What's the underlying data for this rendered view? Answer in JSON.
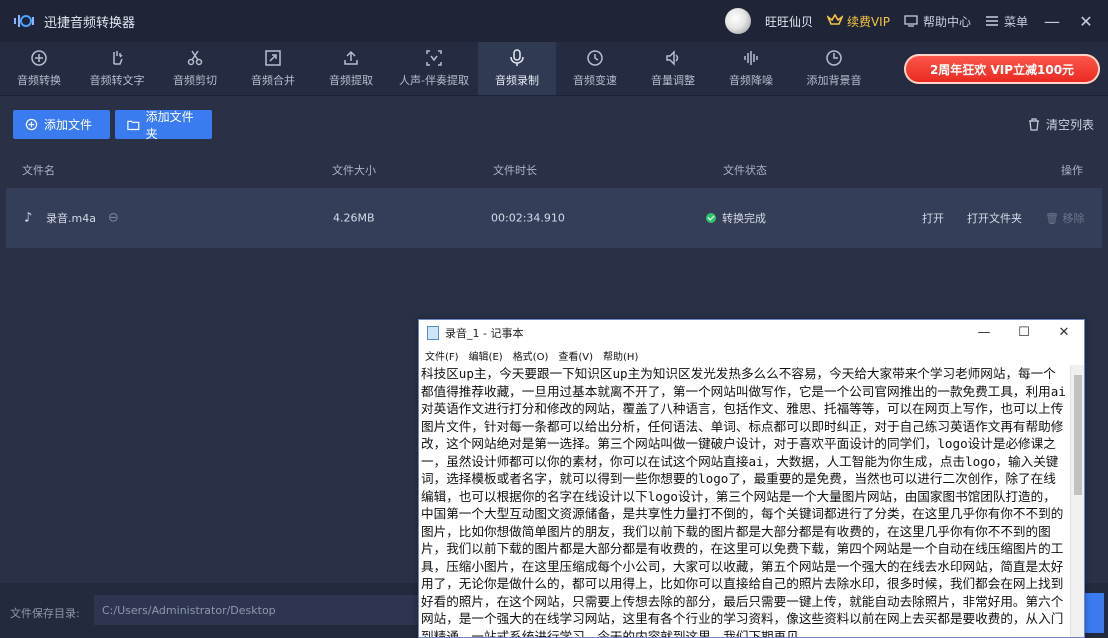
{
  "app": {
    "title": "迅捷音频转换器",
    "username": "旺旺仙贝",
    "vip_label": "续费VIP",
    "help_label": "帮助中心",
    "menu_label": "菜单"
  },
  "toolbar": {
    "tools": [
      {
        "label": "音频转换",
        "icon": "plus-circle-icon"
      },
      {
        "label": "音频转文字",
        "icon": "hand-icon"
      },
      {
        "label": "音频剪切",
        "icon": "scissors-icon"
      },
      {
        "label": "音频合并",
        "icon": "merge-icon"
      },
      {
        "label": "音频提取",
        "icon": "upload-icon"
      },
      {
        "label": "人声-伴奏提取",
        "icon": "voice-icon"
      },
      {
        "label": "音频录制",
        "icon": "microphone-icon"
      },
      {
        "label": "音频变速",
        "icon": "clock-icon"
      },
      {
        "label": "音量调整",
        "icon": "volume-icon"
      },
      {
        "label": "音频降噪",
        "icon": "noise-icon"
      },
      {
        "label": "添加背景音",
        "icon": "background-icon"
      }
    ],
    "active_index": 6,
    "promo_label": "2周年狂欢 VIP立减100元"
  },
  "actions": {
    "add_file": "添加文件",
    "add_folder": "添加文件夹",
    "clear_list": "清空列表"
  },
  "table": {
    "headers": {
      "name": "文件名",
      "size": "文件大小",
      "duration": "文件时长",
      "status": "文件状态",
      "ops": "操作"
    },
    "rows": [
      {
        "name": "录音.m4a",
        "size": "4.26MB",
        "duration": "00:02:34.910",
        "status": "转换完成",
        "open": "打开",
        "open_folder": "打开文件夹",
        "remove": "移除"
      }
    ]
  },
  "footer": {
    "save_label": "文件保存目录:",
    "save_path": "C:/Users/Administrator/Desktop"
  },
  "notepad": {
    "title": "录音_1 - 记事本",
    "menu": [
      "文件(F)",
      "编辑(E)",
      "格式(O)",
      "查看(V)",
      "帮助(H)"
    ],
    "text": "科技区up主，今天要跟一下知识区up主为知识区发光发热多么么不容易，今天给大家带来个学习老师网站，每一个都值得推荐收藏，一旦用过基本就离不开了，第一个网站叫做写作，它是一个公司官网推出的一款免费工具，利用ai对英语作文进行打分和修改的网站，覆盖了八种语言，包括作文、雅思、托福等等，可以在网页上写作，也可以上传图片文件，针对每一条都可以给出分析，任何语法、单词、标点都可以即时纠正，对于自己练习英语作文再有帮助修改，这个网站绝对是第一选择。第三个网站叫做一键破户设计，对于喜欢平面设计的同学们，logo设计是必修课之一，虽然设计师都可以你的素材，你可以在试这个网站直接ai，大数据，人工智能为你生成，点击logo，输入关键词，选择模板或者名字，就可以得到一些你想要的logo了，最重要的是免费，当然也可以进行二次创作，除了在线编辑，也可以根据你的名字在线设计以下logo设计，第三个网站是一个大量图片网站，由国家图书馆团队打造的，中国第一个大型互动图文资源储备，是共享性力量打不倒的，每个关键词都进行了分类，在这里几乎你有你不不到的图片，比如你想做简单图片的朋友，我们以前下载的图片都是大部分都是有收费的，在这里几乎你有你不不到的图片，我们以前下载的图片都是大部分都是有收费的，在这里可以免费下载，第四个网站是一个自动在线压缩图片的工具，压缩小图片，在这里压缩成每个小公司，大家可以收藏，第五个网站是一个强大的在线去水印网站，简直是太好用了，无论你是做什么的，都可以用得上，比如你可以直接给自己的照片去除水印，很多时候，我们都会在网上找到好看的照片，在这个网站，只需要上传想去除的部分，最后只需要一键上传，就能自动去除照片，非常好用。第六个网站，是一个强大的在线学习网站，这里有各个行业的学习资料，像这些资料以前在网上去买都是要收费的，从入门到精通，一站式系统进行学习，今天的内容就到这里，我们下期再见。"
  },
  "colors": {
    "accent": "#3a7bef",
    "status_ok": "#33c26b",
    "promo": "#e7261e",
    "vip": "#f5c542"
  }
}
